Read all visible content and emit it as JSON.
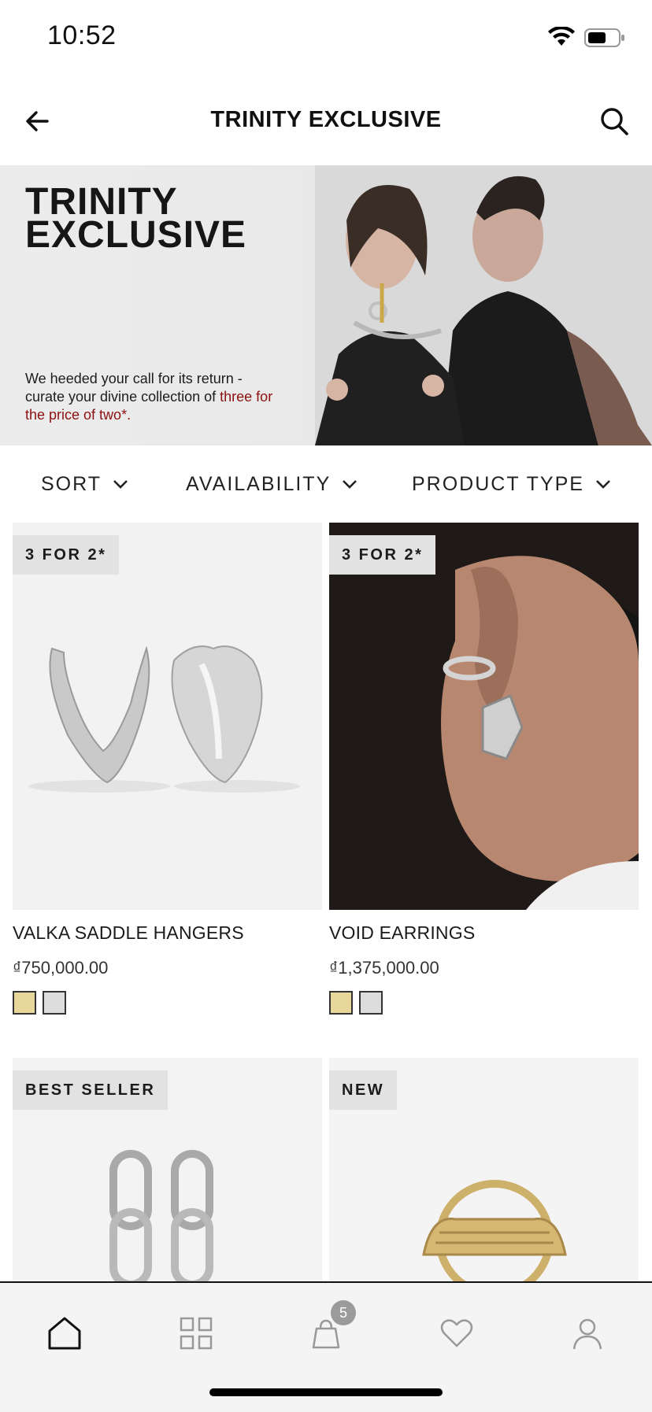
{
  "status_bar": {
    "time": "10:52"
  },
  "header": {
    "title": "TRINITY EXCLUSIVE"
  },
  "hero": {
    "headline_line1": "TRINITY",
    "headline_line2": "EXCLUSIVE",
    "description": "We heeded your call for its return - curate your divine collection of",
    "offer": "three for the price of two*."
  },
  "filters": [
    {
      "label": "SORT"
    },
    {
      "label": "AVAILABILITY"
    },
    {
      "label": "PRODUCT TYPE"
    }
  ],
  "products": [
    {
      "badge": "3 FOR 2*",
      "name": "VALKA SADDLE HANGERS",
      "price": "₫750,000.00",
      "swatches": [
        "#e7d79b",
        "#dddddd"
      ]
    },
    {
      "badge": "3 FOR 2*",
      "name": "VOID EARRINGS",
      "price": "₫1,375,000.00",
      "swatches": [
        "#e7d79b",
        "#dddddd"
      ]
    },
    {
      "badge": "BEST SELLER"
    },
    {
      "badge": "NEW"
    }
  ],
  "tabbar": {
    "items": [
      "home-icon",
      "grid-icon",
      "bag-icon",
      "heart-icon",
      "user-icon"
    ],
    "cart_count": "5"
  },
  "colors": {
    "accent": "#8d1010",
    "badge_bg": "#e2e2e2",
    "tabbar_bg": "#f4f4f4"
  }
}
